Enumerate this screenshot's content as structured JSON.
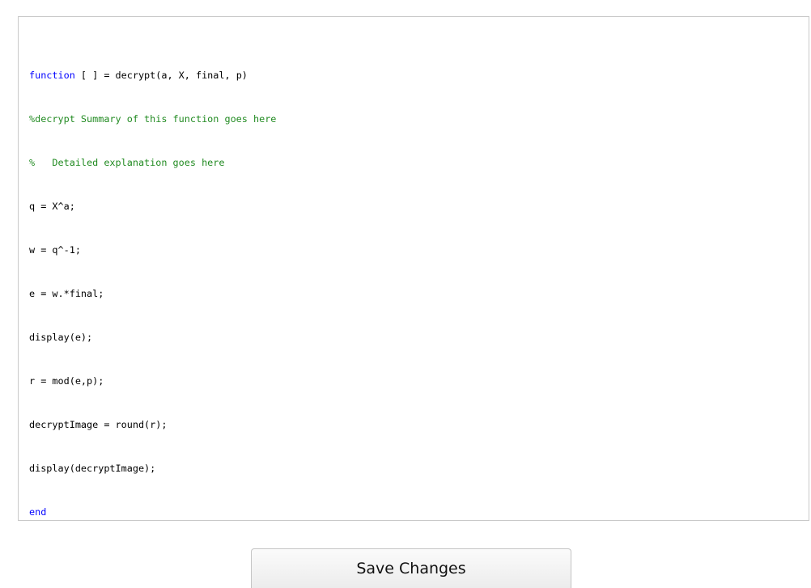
{
  "editor": {
    "lines": [
      {
        "kw": "function",
        "rest": " [ ] = decrypt(a, X, final, p)"
      },
      {
        "comment": "%decrypt Summary of this function goes here"
      },
      {
        "comment": "%   Detailed explanation goes here"
      },
      {
        "text": "q = X^a;"
      },
      {
        "text": "w = q^-1;"
      },
      {
        "text": "e = w.*final;"
      },
      {
        "text": "display(e);"
      },
      {
        "text": "r = mod(e,p);"
      },
      {
        "text": "decryptImage = round(r);"
      },
      {
        "text": "display(decryptImage);"
      },
      {
        "kw": "end"
      }
    ],
    "colors": {
      "keyword": "#0000ff",
      "comment": "#228b22",
      "text": "#000000"
    }
  },
  "actions": {
    "save_label": "Save Changes"
  }
}
